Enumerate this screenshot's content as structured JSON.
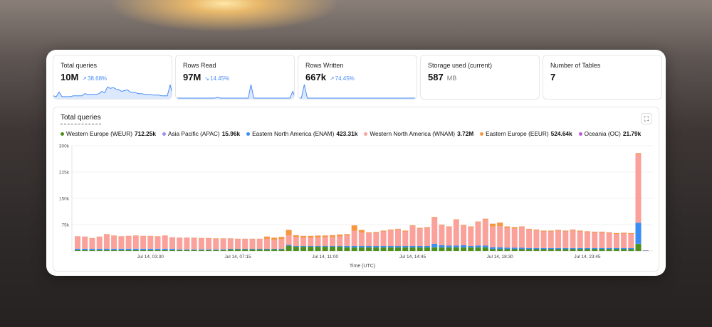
{
  "stats": [
    {
      "label": "Total queries",
      "value": "10M",
      "change": "38.68%",
      "trend": "up",
      "spark": [
        3,
        2,
        8,
        2,
        2,
        2,
        2,
        3,
        3,
        3,
        3,
        6,
        5,
        5,
        5,
        5,
        6,
        9,
        7,
        15,
        13,
        14,
        12,
        11,
        9,
        10,
        11,
        8,
        8,
        7,
        6,
        6,
        5,
        5,
        5,
        4,
        4,
        4,
        3,
        3,
        3,
        18,
        1
      ]
    },
    {
      "label": "Rows Read",
      "value": "97M",
      "change": "14.45%",
      "trend": "down",
      "spark": [
        0,
        0,
        0,
        0,
        0,
        0,
        0,
        0,
        0,
        0,
        0,
        0,
        0,
        0,
        0,
        1,
        0,
        0,
        0,
        0,
        0,
        0,
        0,
        0,
        0,
        0,
        0,
        18,
        0,
        0,
        0,
        0,
        0,
        0,
        0,
        0,
        0,
        0,
        0,
        0,
        0,
        0,
        9,
        0
      ]
    },
    {
      "label": "Rows Written",
      "value": "667k",
      "change": "74.45%",
      "trend": "up",
      "spark": [
        0,
        0,
        18,
        0,
        0,
        0,
        0,
        0,
        0,
        0,
        0,
        0,
        0,
        0,
        0,
        0,
        0,
        0,
        0,
        0,
        0,
        0,
        0,
        0,
        0,
        0,
        0,
        0,
        0,
        0,
        0,
        0,
        0,
        0,
        0,
        0,
        0,
        0,
        0,
        0,
        0
      ]
    },
    {
      "label": "Storage used (current)",
      "value": "587",
      "unit": "MB"
    },
    {
      "label": "Number of Tables",
      "value": "7"
    }
  ],
  "chart_title": "Total queries",
  "legend": [
    {
      "name": "Western Europe (WEUR)",
      "total": "712.25k",
      "color": "#4d8f1f"
    },
    {
      "name": "Asia Pacific (APAC)",
      "total": "15.96k",
      "color": "#a58cf0"
    },
    {
      "name": "Eastern North America (ENAM)",
      "total": "423.31k",
      "color": "#3a8ef3"
    },
    {
      "name": "Western North America (WNAM)",
      "total": "3.72M",
      "color": "#f9a19a"
    },
    {
      "name": "Eastern Europe (EEUR)",
      "total": "524.64k",
      "color": "#f6973e"
    },
    {
      "name": "Oceania (OC)",
      "total": "21.79k",
      "color": "#c25be0"
    }
  ],
  "chart_data": {
    "type": "bar",
    "stacked": true,
    "title": "Total queries",
    "xlabel": "Time (UTC)",
    "ylabel": "",
    "ylim": [
      0,
      300000
    ],
    "yticks": [
      "75k",
      "150k",
      "225k",
      "300k"
    ],
    "ytick_values": [
      75000,
      150000,
      225000,
      300000
    ],
    "xticks": [
      {
        "label": "Jul 14, 03:30",
        "index": 10
      },
      {
        "label": "Jul 14, 07:15",
        "index": 22
      },
      {
        "label": "Jul 14, 11:00",
        "index": 34
      },
      {
        "label": "Jul 14, 14:45",
        "index": 46
      },
      {
        "label": "Jul 14, 18:30",
        "index": 58
      },
      {
        "label": "Jul 14, 23:45",
        "index": 70
      }
    ],
    "unit": "k",
    "stack_totals": [
      42,
      41,
      37,
      41,
      48,
      44,
      42,
      43,
      44,
      43,
      43,
      42,
      44,
      39,
      38,
      38,
      38,
      37,
      37,
      36,
      36,
      36,
      35,
      35,
      35,
      35,
      41,
      38,
      40,
      60,
      45,
      43,
      43,
      44,
      44,
      45,
      47,
      48,
      73,
      60,
      53,
      54,
      58,
      61,
      63,
      58,
      73,
      66,
      68,
      97,
      75,
      70,
      90,
      74,
      70,
      84,
      92,
      78,
      81,
      70,
      68,
      70,
      63,
      61,
      58,
      58,
      60,
      58,
      61,
      58,
      56,
      55,
      55,
      53,
      51,
      52,
      51,
      279,
      2
    ],
    "series": [
      {
        "name": "Western Europe (WEUR)",
        "values": [
          2,
          2,
          2,
          2,
          2,
          2,
          2,
          2,
          2,
          2,
          2,
          2,
          2,
          2,
          2,
          2,
          2,
          2,
          2,
          2,
          2,
          4,
          4,
          4,
          4,
          4,
          4,
          4,
          4,
          15,
          12,
          12,
          12,
          12,
          12,
          12,
          12,
          10,
          10,
          10,
          10,
          10,
          10,
          10,
          10,
          10,
          10,
          10,
          10,
          10,
          10,
          10,
          10,
          10,
          10,
          10,
          10,
          5,
          5,
          5,
          5,
          5,
          5,
          5,
          5,
          5,
          5,
          5,
          5,
          5,
          5,
          5,
          5,
          5,
          5,
          5,
          5,
          20,
          0
        ]
      },
      {
        "name": "Asia Pacific (APAC)",
        "values": [
          0.2,
          0.2,
          0.2,
          0.2,
          0.2,
          0.2,
          0.2,
          0.2,
          0.2,
          0.2,
          0.2,
          0.2,
          0.2,
          0.2,
          0.2,
          0.2,
          0.2,
          0.2,
          0.2,
          0.2,
          0.2,
          0.2,
          0.2,
          0.2,
          0.2,
          0.2,
          0.2,
          0.2,
          0.2,
          0.2,
          0.2,
          0.2,
          0.2,
          0.2,
          0.2,
          0.2,
          0.2,
          0.2,
          0.2,
          0.2,
          0.2,
          0.2,
          0.2,
          0.2,
          0.2,
          0.2,
          0.2,
          0.2,
          0.2,
          0.2,
          0.2,
          0.2,
          0.2,
          0.2,
          0.2,
          0.2,
          0.2,
          0.2,
          0.2,
          0.2,
          0.2,
          0.2,
          0.2,
          0.2,
          0.2,
          0.2,
          0.2,
          0.2,
          0.2,
          0.2,
          0.2,
          0.2,
          0.2,
          0.2,
          0.2,
          0.2,
          0.2,
          0.5,
          0
        ]
      },
      {
        "name": "Eastern North America (ENAM)",
        "values": [
          4,
          4,
          4,
          4,
          4,
          4,
          4,
          4,
          4,
          4,
          4,
          4,
          4,
          4,
          2,
          2,
          2,
          2,
          2,
          2,
          2,
          2,
          2,
          2,
          2,
          2,
          2,
          2,
          2,
          2,
          2,
          2,
          2,
          2,
          2,
          2,
          2,
          4,
          4,
          4,
          4,
          4,
          4,
          4,
          4,
          4,
          4,
          4,
          4,
          10,
          6,
          5,
          5,
          6,
          4,
          5,
          5,
          5,
          5,
          4,
          4,
          4,
          3,
          3,
          3,
          3,
          3,
          3,
          3,
          3,
          3,
          3,
          3,
          3,
          3,
          3,
          3,
          60,
          1
        ]
      },
      {
        "name": "Western North America (WNAM)",
        "values": "derived: stack_totals minus other series"
      },
      {
        "name": "Eastern Europe (EEUR)",
        "values": [
          1,
          1,
          1,
          1,
          1,
          1,
          1,
          1,
          1,
          1,
          1,
          1,
          1,
          1,
          1,
          1,
          1,
          1,
          1,
          1,
          1,
          1,
          1,
          1,
          1,
          1,
          6,
          6,
          6,
          15,
          5,
          5,
          5,
          5,
          5,
          5,
          5,
          3,
          15,
          7,
          2,
          2,
          2,
          2,
          2,
          2,
          2,
          2,
          2,
          2,
          2,
          2,
          2,
          2,
          2,
          2,
          2,
          8,
          10,
          4,
          4,
          2,
          2,
          2,
          2,
          2,
          2,
          2,
          2,
          2,
          2,
          2,
          2,
          2,
          2,
          2,
          2,
          3,
          0
        ]
      },
      {
        "name": "Oceania (OC)",
        "values": [
          0.3,
          0.3,
          0.3,
          0.3,
          0.3,
          0.3,
          0.3,
          0.3,
          0.3,
          0.3,
          0.3,
          0.3,
          0.3,
          0.3,
          0.3,
          0.3,
          0.3,
          0.3,
          0.3,
          0.3,
          0.3,
          0.3,
          0.3,
          0.3,
          0.3,
          0.3,
          0.3,
          0.3,
          0.3,
          0.3,
          0.3,
          0.3,
          0.3,
          0.3,
          0.3,
          0.3,
          0.3,
          0.3,
          0.3,
          0.3,
          0.3,
          0.3,
          0.3,
          0.3,
          0.3,
          0.3,
          0.3,
          0.3,
          0.3,
          0.3,
          0.3,
          0.3,
          0.3,
          0.3,
          0.3,
          0.3,
          0.3,
          0.3,
          0.3,
          0.3,
          0.3,
          0.3,
          0.3,
          0.3,
          0.3,
          0.3,
          0.3,
          0.3,
          0.3,
          0.3,
          0.3,
          0.3,
          0.3,
          0.3,
          0.3,
          0.3,
          0.3,
          0.5,
          0
        ]
      }
    ]
  }
}
